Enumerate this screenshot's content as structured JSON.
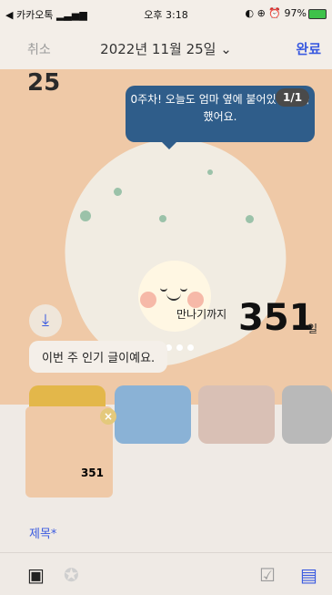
{
  "status": {
    "left": "◀ 카카오톡",
    "signal": "▂▃▅▆",
    "time": "오후 3:18",
    "right": "◐ ⊕ ⏰ 97%"
  },
  "nav": {
    "cancel": "취소",
    "date": "2022년 11월 25일",
    "date_chevron": "⌄",
    "done": "완료"
  },
  "card": {
    "days_label": "25 ",
    "bubble_text": "0주차! 오늘도 엄마 옆에 붙어있어 행복했어요.",
    "pager": "1/1",
    "meet_label": "만나기까지",
    "meet_number": "351",
    "meet_unit": "일",
    "popular": "이번 주 인기 글이예요.",
    "dot_count": 5
  },
  "preview": {
    "number": "351",
    "close": "×"
  },
  "form": {
    "title_label": "제목*"
  },
  "icons": {
    "gallery": "gallery-icon",
    "palette": "palette-icon",
    "calendar": "calendar-check-icon",
    "document": "document-icon",
    "download": "download-icon"
  },
  "colors": {
    "accent": "#3a5ae0",
    "bubble": "#2f5d8a",
    "card_bg": "#efc9a7"
  }
}
